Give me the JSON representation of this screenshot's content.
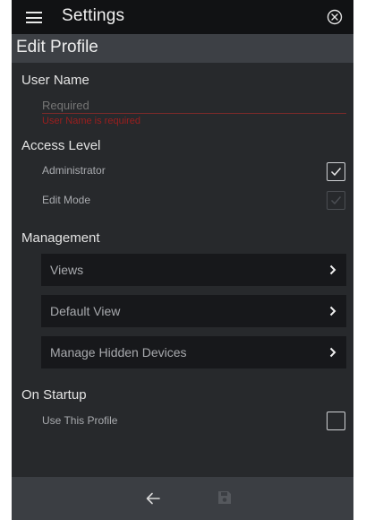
{
  "header": {
    "title": "Settings",
    "menu_icon": "hamburger-menu-icon",
    "close_icon": "close-circle-icon"
  },
  "subheader": {
    "title": "Edit Profile"
  },
  "user_name": {
    "label": "User Name",
    "placeholder": "Required",
    "value": "",
    "error": "User Name is required"
  },
  "access_level": {
    "label": "Access Level",
    "options": [
      {
        "label": "Administrator",
        "checked": true,
        "enabled": true
      },
      {
        "label": "Edit Mode",
        "checked": true,
        "enabled": false
      }
    ]
  },
  "management": {
    "label": "Management",
    "items": [
      {
        "label": "Views"
      },
      {
        "label": "Default View"
      },
      {
        "label": "Manage Hidden Devices"
      }
    ]
  },
  "startup": {
    "label": "On Startup",
    "option": {
      "label": "Use This Profile",
      "checked": false
    }
  },
  "toolbar": {
    "back_icon": "arrow-left-icon",
    "save_icon": "floppy-disk-save-icon",
    "save_enabled": false
  },
  "colors": {
    "background": "#27292c",
    "topbar": "#111214",
    "subheader": "#3d4045",
    "row": "#17181b",
    "placeholder": "#f0a63a",
    "error": "#9c1e1e"
  }
}
